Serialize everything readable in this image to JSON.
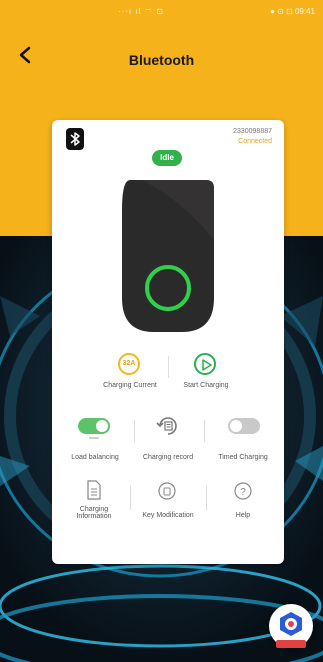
{
  "status_bar": {
    "left": "··‧ı ıl ⌔ ⊡",
    "right": "● ⊙ ⊡ 09:41"
  },
  "header": {
    "title": "Bluetooth",
    "back_icon": "chevron-left-icon"
  },
  "device": {
    "id": "2330098887",
    "connection": "Connected",
    "state": "Idle"
  },
  "actions_row1": {
    "current_value": "32A",
    "current_label": "Charging Current",
    "start_label": "Start Charging"
  },
  "actions_row2": {
    "load_label": "Load balancing",
    "load_enabled": true,
    "record_label": "Charging record",
    "timed_label": "Timed Charging",
    "timed_enabled": false
  },
  "actions_row3": {
    "info_label": "Charging Information",
    "key_label": "Key Modification",
    "help_label": "Help"
  },
  "colors": {
    "accent_yellow": "#f6b21a",
    "green": "#2fb24a",
    "charger_body": "#2b2a2a"
  }
}
